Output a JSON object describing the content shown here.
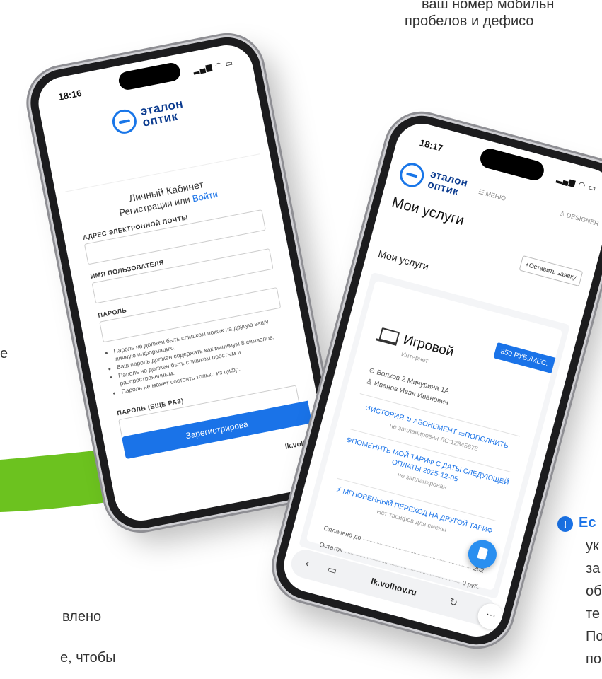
{
  "background": {
    "top_right_line1": "ваш номер мобильн",
    "top_right_line2": "пробелов и дефисо",
    "left_fragment_e": "е",
    "left_fragment_vleno": "влено",
    "left_fragment_chtoby": "е, чтобы",
    "notice_icon": "!",
    "notice_title": "Ес",
    "notice_lines": [
      "ук",
      "за",
      "об",
      "те",
      "По",
      "по"
    ],
    "accent_green": "#6cc21f"
  },
  "phone_left": {
    "time": "18:16",
    "status_icons": "signal-wifi-battery",
    "logo_line1": "эталон",
    "logo_line2": "оптик",
    "form_title": "Личный Кабинет",
    "form_subtitle_text": "Регистрация или ",
    "form_subtitle_link": "Войти",
    "email_label": "АДРЕС ЭЛЕКТРОННОЙ ПОЧТЫ",
    "username_label": "ИМЯ ПОЛЬЗОВАТЕЛЯ",
    "password_label": "ПАРОЛЬ",
    "password_hints": [
      "Пароль не должен быть слишком похож на другую вашу личную информацию.",
      "Ваш пароль должен содержать как минимум 8 символов.",
      "Пароль не должен быть слишком простым и распространенным.",
      "Пароль не может состоять только из цифр."
    ],
    "password_repeat_label": "ПАРОЛЬ (ЕЩЕ РАЗ)",
    "register_button": "Зарегистрирова",
    "url": "lk.volh"
  },
  "phone_right": {
    "time": "18:17",
    "status_icons": "signal-wifi-battery",
    "logo_line1": "эталон",
    "logo_line2": "оптик",
    "menu_label": "МЕНЮ",
    "user_label": "DESIGNER",
    "page_title": "Мои услуги",
    "order_button": "+Оставить заявку",
    "section_title": "Мои услуги",
    "service": {
      "price": "850 РУБ./МЕС.",
      "name": "Игровой",
      "type": "Интернет",
      "address": "Волхов 2 Мичурина 1А",
      "owner": "Иванов Иван Иванович"
    },
    "actions": {
      "history": "ИСТОРИЯ",
      "subscription": "АБОНЕМЕНТ",
      "topup": "ПОПОЛНИТЬ",
      "not_scheduled": "не запланирован",
      "account": "ЛС:12345678",
      "change_tariff": "ПОМЕНЯТЬ МОЙ ТАРИФ С ДАТЫ СЛЕДУЮЩЕЙ ОПЛАТЫ 2025-12-05",
      "change_status": "не запланирован",
      "instant_switch": "МГНОВЕННЫЙ ПЕРЕХОД НА ДРУГОЙ ТАРИФ",
      "no_tariffs": "Нет тарифов для смены"
    },
    "paid_until_label": "Оплачено до",
    "paid_until_value": "202",
    "balance_label": "Остаток",
    "balance_value": "0 руб.",
    "url": "lk.volhov.ru",
    "more_glyph": "···"
  }
}
